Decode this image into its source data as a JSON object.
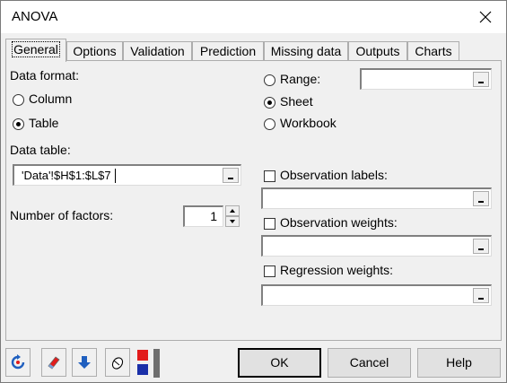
{
  "window": {
    "title": "ANOVA"
  },
  "tabs": [
    {
      "label": "General",
      "active": true
    },
    {
      "label": "Options"
    },
    {
      "label": "Validation"
    },
    {
      "label": "Prediction"
    },
    {
      "label": "Missing data"
    },
    {
      "label": "Outputs"
    },
    {
      "label": "Charts"
    }
  ],
  "general": {
    "data_format_label": "Data format:",
    "format_options": {
      "column": "Column",
      "table": "Table",
      "selected": "Table"
    },
    "data_table_label": "Data table:",
    "data_table_value": "'Data'!$H$1:$L$7",
    "factors_label": "Number of factors:",
    "factors_value": "1",
    "range_options": {
      "range": "Range:",
      "sheet": "Sheet",
      "workbook": "Workbook",
      "selected": "Sheet"
    },
    "range_value": "",
    "observation_labels": {
      "label": "Observation labels:",
      "checked": false,
      "value": ""
    },
    "observation_weights": {
      "label": "Observation weights:",
      "checked": false,
      "value": ""
    },
    "regression_weights": {
      "label": "Regression weights:",
      "checked": false,
      "value": ""
    }
  },
  "buttons": {
    "ok": "OK",
    "cancel": "Cancel",
    "help": "Help"
  },
  "toolbar_icons": [
    "reset-icon",
    "eraser-icon",
    "down-arrow-icon",
    "mouse-icon",
    "color-squares-icon"
  ],
  "colors": {
    "accent_blue": "#1f5fbf",
    "red": "#e21b1b",
    "dark_blue": "#1a2fa8"
  }
}
